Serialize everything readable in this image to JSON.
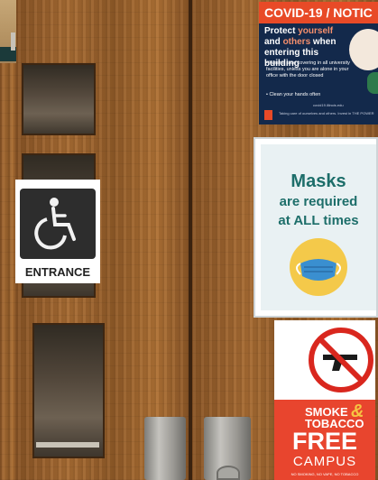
{
  "covid_sign": {
    "title": "COVID-19 / NOTIC",
    "headline_prefix": "Protect ",
    "headline_highlight1": "yourself",
    "headline_mid": " and ",
    "headline_highlight2": "others",
    "headline_suffix": " when entering this building",
    "bullet_1": "• Wear a face covering in all university facilities, unless you are alone in your office with the door closed",
    "bullet_2": "• Clean your hands often",
    "url": "covid19.illinois.edu",
    "footer": "Taking care of ourselves and others. Invest in THE POWER",
    "accent_color": "#e84a27",
    "background_color": "#13294b"
  },
  "masks_sign": {
    "line_1": "Masks",
    "line_2": "are required",
    "line_3": "at ALL times",
    "icon": "face-mask-icon",
    "text_color": "#1d6e6a"
  },
  "accessible_entrance_sign": {
    "icon": "wheelchair-icon",
    "label": "ENTRANCE"
  },
  "smoke_free_sign": {
    "icon": "no-guns-icon",
    "line_1": "SMOKE",
    "line_2": "TOBACCO",
    "ampersand": "&",
    "line_3": "FREE",
    "line_4": "CAMPUS",
    "fine_print": "NO SMOKING, NO VAPE, NO TOBACCO",
    "panel_color": "#e8452e"
  }
}
